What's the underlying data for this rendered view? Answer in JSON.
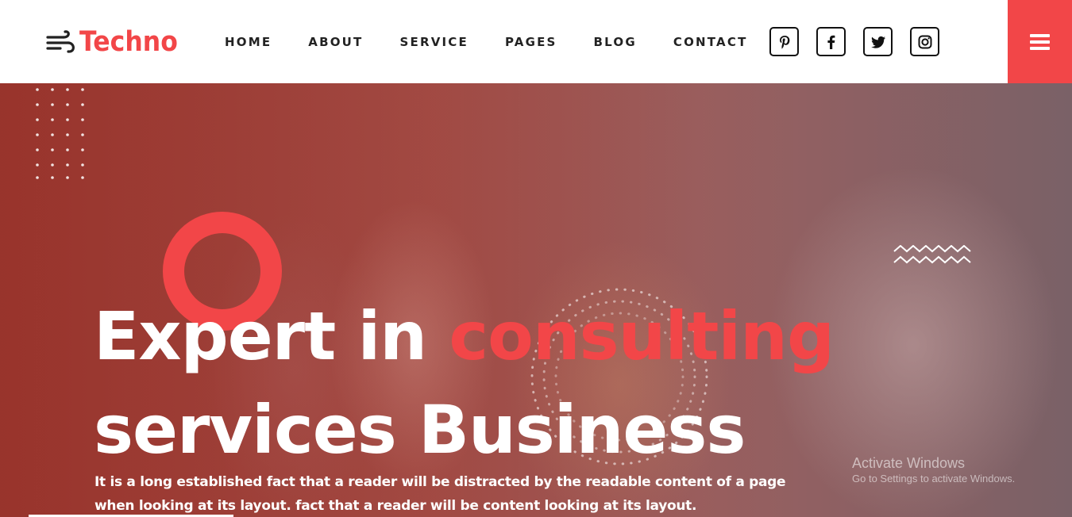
{
  "brand": {
    "name": "Techno",
    "accent": "#f24648"
  },
  "nav": {
    "items": [
      {
        "label": "HOME"
      },
      {
        "label": "ABOUT"
      },
      {
        "label": "SERVICE"
      },
      {
        "label": "PAGES"
      },
      {
        "label": "BLOG"
      },
      {
        "label": "CONTACT"
      }
    ]
  },
  "socials": [
    "pinterest-icon",
    "facebook-icon",
    "twitter-icon",
    "instagram-icon"
  ],
  "hero": {
    "headline_part1": "Expert in ",
    "headline_accent": "consulting",
    "headline_line2": "services Business",
    "description": "It is a long established fact that a reader will be distracted by the readable content of a page when looking at its layout. fact that a reader will be content looking at its layout."
  },
  "watermark": {
    "title": "Activate Windows",
    "subtitle": "Go to Settings to activate Windows."
  }
}
